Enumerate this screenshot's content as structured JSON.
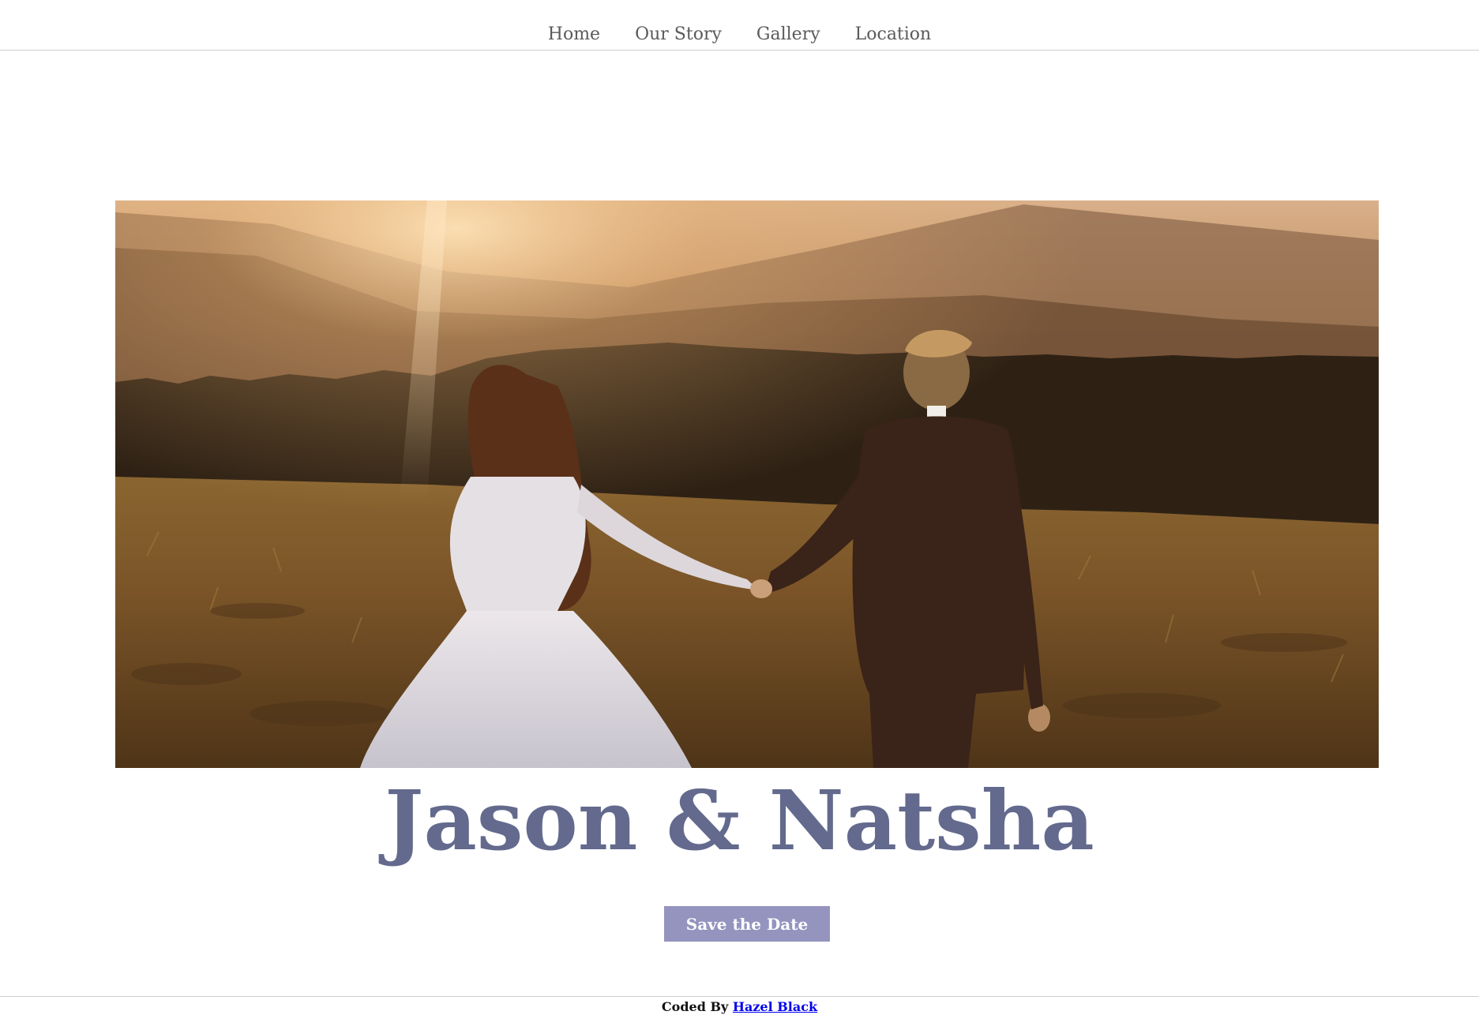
{
  "nav": {
    "items": [
      {
        "label": "Home"
      },
      {
        "label": "Our Story"
      },
      {
        "label": "Gallery"
      },
      {
        "label": "Location"
      }
    ]
  },
  "hero": {
    "image_description_icon": "couple-photo"
  },
  "title": "Jason & Natsha",
  "cta": {
    "label": "Save the Date"
  },
  "footer": {
    "prefix": "Coded By",
    "author": "Hazel Black"
  },
  "colors": {
    "title": "#636a8d",
    "button": "#9494bf",
    "nav_text": "#5a5a5a",
    "link": "#0000ee"
  }
}
